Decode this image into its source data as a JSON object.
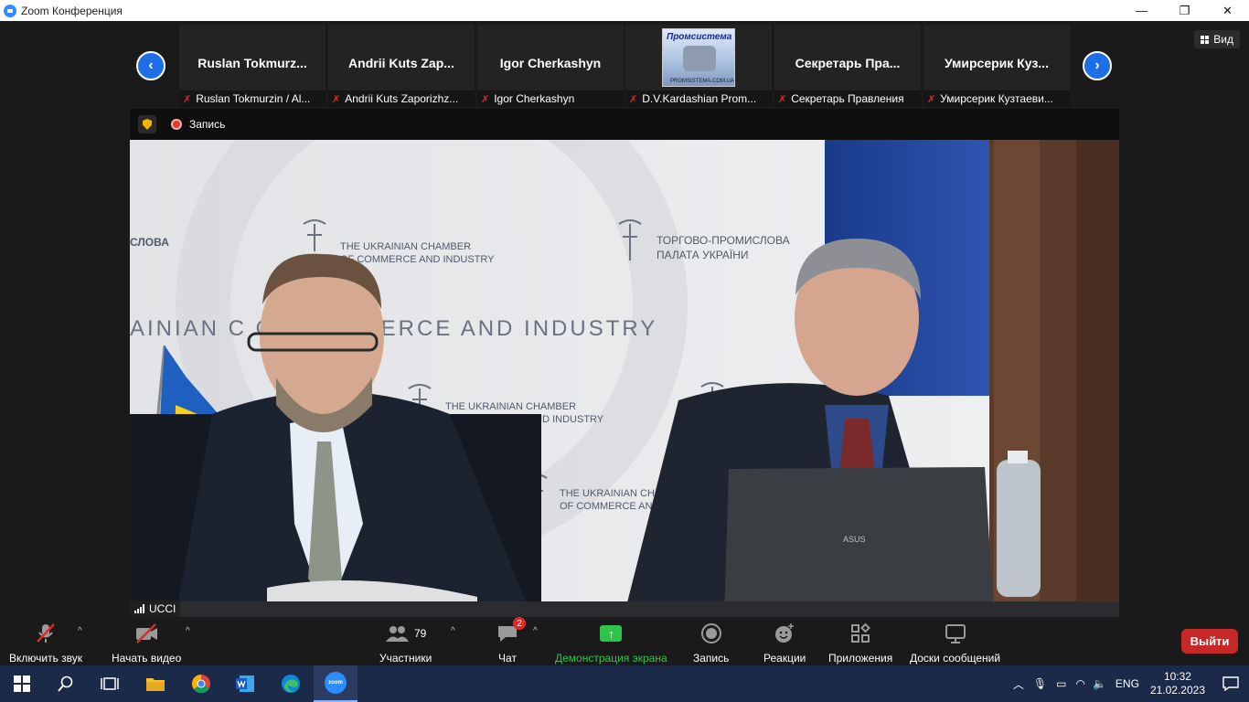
{
  "window": {
    "title": "Zoom Конференция",
    "minimize": "—",
    "maximize": "❐",
    "close": "✕"
  },
  "strip": {
    "prev": "‹",
    "next": "›",
    "view_label": "Вид",
    "thumbs": [
      {
        "big": "Ruslan  Tokmurz...",
        "caption": "Ruslan Tokmurzin / Al..."
      },
      {
        "big": "Andrii Kuts  Zap...",
        "caption": "Andrii Kuts Zaporizhz..."
      },
      {
        "big": "Igor Cherkashyn",
        "caption": "Igor Cherkashyn"
      },
      {
        "big": "",
        "caption": "D.V.Kardashian Prom...",
        "logo_top": "Промсистема",
        "logo_bottom": "PROMSISTEMA.COM.UA"
      },
      {
        "big": "Секретарь  Пра...",
        "caption": "Секретарь Правления"
      },
      {
        "big": "Умирсерик  Куз...",
        "caption": "Умирсерик Кузтаеви..."
      }
    ]
  },
  "video": {
    "record_label": "Запись",
    "speaker_name": "UCCI",
    "banner": {
      "line_top": "СЛОВА",
      "en1": "THE UKRAINIAN CHAMBER",
      "en2": "OF COMMERCE AND INDUSTRY",
      "ua1": "ТОРГОВО-ПРОМИСЛОВА",
      "ua2": "ПАЛАТА УКРАЇНИ",
      "big": "AINIAN C       OF COMMERCE AND INDUSTRY",
      "en3": "THE UKRAINIAN CHAMBER",
      "en4": "COMMERCE AND INDUSTRY",
      "en5": "THE UKRAINIAN CH",
      "en6": "OF COMMERCE AND",
      "laptop": "ASUS"
    }
  },
  "toolbar": {
    "audio": "Включить звук",
    "video": "Начать видео",
    "participants_count": "79",
    "participants": "Участники",
    "chat_badge": "2",
    "chat": "Чат",
    "share": "Демонстрация экрана",
    "record": "Запись",
    "reactions": "Реакции",
    "apps": "Приложения",
    "whiteboards": "Доски сообщений",
    "leave": "Выйти",
    "share_color": "#2ec44a"
  },
  "taskbar": {
    "lang": "ENG",
    "time": "10:32",
    "date": "21.02.2023"
  }
}
